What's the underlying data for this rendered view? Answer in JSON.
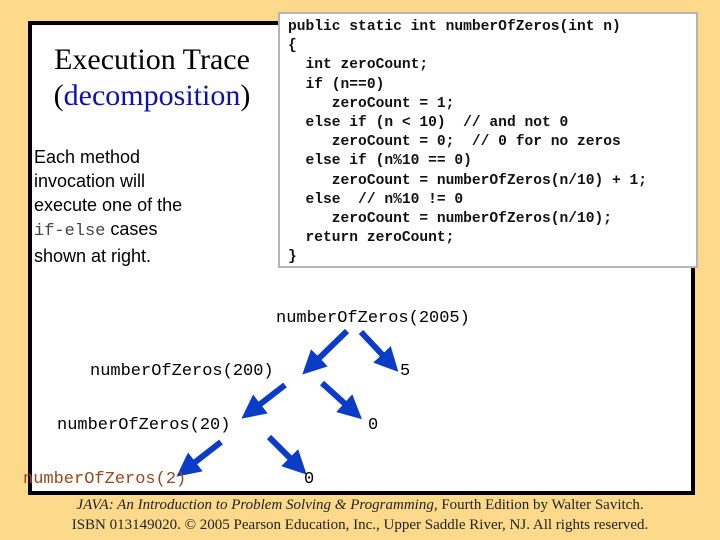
{
  "slide": {
    "title_line1": "Execution Trace",
    "title_paren_open": "(",
    "title_accent": "decomposition",
    "title_paren_close": ")",
    "description": {
      "line1": "Each method",
      "line2": "invocation will",
      "line3": "execute one of the",
      "code_term": "if-else",
      "line4_rest": " cases",
      "line5": "shown at right."
    }
  },
  "code": {
    "lines": [
      "public static int numberOfZeros(int n)",
      "{",
      "  int zeroCount;",
      "  if (n==0)",
      "     zeroCount = 1;",
      "  else if (n < 10)  // and not 0",
      "     zeroCount = 0;  // 0 for no zeros",
      "  else if (n%10 == 0)",
      "     zeroCount = numberOfZeros(n/10) + 1;",
      "  else  // n%10 != 0",
      "     zeroCount = numberOfZeros(n/10);",
      "  return zeroCount;",
      "}"
    ]
  },
  "trace": {
    "nodes": [
      {
        "id": "root",
        "label": "numberOfZeros(2005)"
      },
      {
        "id": "n200",
        "label": "numberOfZeros(200)"
      },
      {
        "id": "d5",
        "label": "5"
      },
      {
        "id": "n20",
        "label": "numberOfZeros(20)"
      },
      {
        "id": "d0a",
        "label": "0"
      },
      {
        "id": "n2",
        "label": "numberOfZeros(2)"
      },
      {
        "id": "d0b",
        "label": "0"
      }
    ],
    "arrow_color": "#0A3CC8",
    "highlight_color": "#A0441A"
  },
  "footer": {
    "book_title": "JAVA: An Introduction to Problem Solving & Programming",
    "edition": ", Fourth Edition by Walter Savitch.",
    "line2": "ISBN 013149020. © 2005 Pearson Education, Inc., Upper Saddle River, NJ. All rights reserved."
  }
}
